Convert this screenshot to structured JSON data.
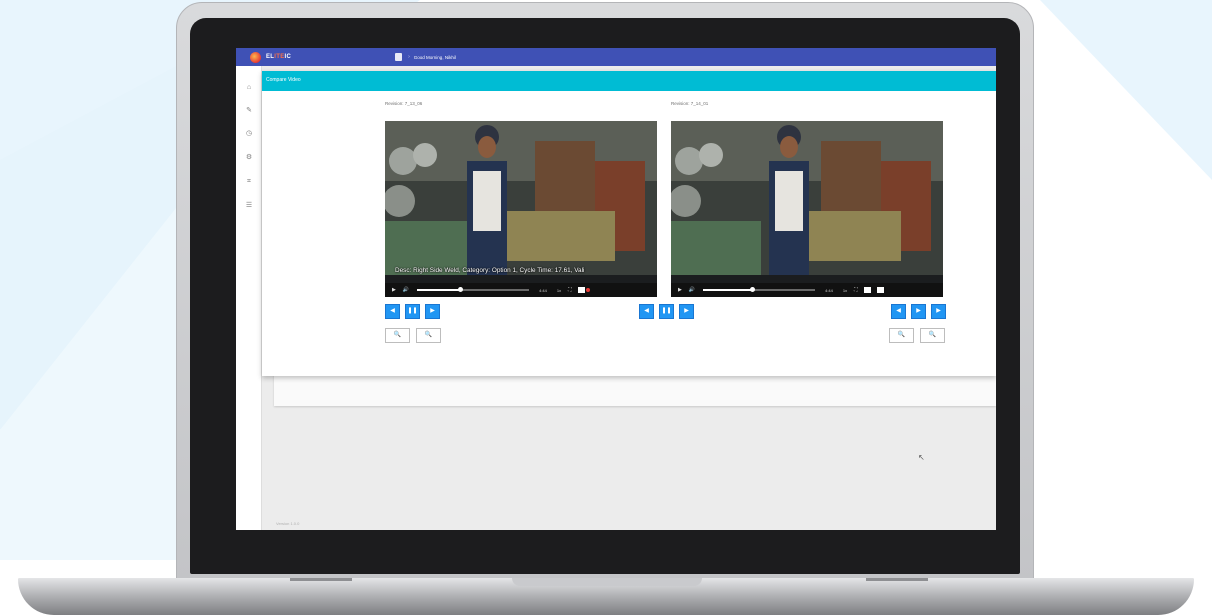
{
  "app": {
    "brand_prefix": "EL",
    "brand_accent": "ITE",
    "brand_suffix": "IC",
    "greeting": "Good Morning, Nikhil",
    "chevron": "›",
    "colors": {
      "topbar": "#3f51b5",
      "header": "#00bcd4",
      "button": "#2196f3"
    }
  },
  "sidebar": {
    "items": [
      {
        "icon": "home-icon",
        "glyph": "⌂"
      },
      {
        "icon": "pencil-icon",
        "glyph": "✎"
      },
      {
        "icon": "timer-icon",
        "glyph": "◷"
      },
      {
        "icon": "gear-icon",
        "glyph": "⚙"
      },
      {
        "icon": "tag-icon",
        "glyph": "⌗"
      },
      {
        "icon": "list-icon",
        "glyph": "☰"
      }
    ]
  },
  "page": {
    "title": "Compare Video",
    "left_video": {
      "label": "Revision: 7_13_06",
      "caption": "Desc: Right Side Weld, Category: Option 1, Cycle Time: 17.61, Vali",
      "time": "4:44",
      "speed": "1x",
      "progress": 0.38
    },
    "right_video": {
      "label": "Revision: 7_14_01",
      "time": "4:44",
      "speed": "1x",
      "progress": 0.44
    },
    "buttons": {
      "rewind": "◀",
      "pause": "❚❚",
      "forward": "▶",
      "zoom_in": "🔍",
      "zoom_out": "🔍"
    },
    "player": {
      "play": "▶",
      "volume": "🔊",
      "fit": "⛶"
    },
    "version": "Version 1.0.0"
  }
}
